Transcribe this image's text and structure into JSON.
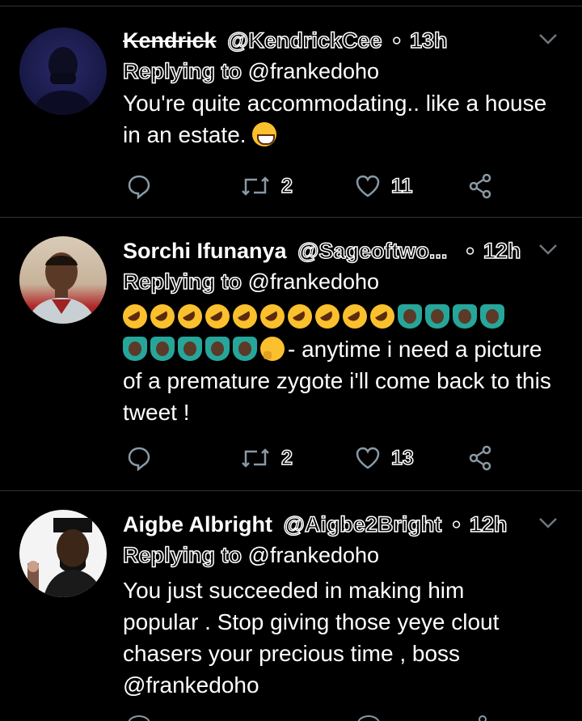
{
  "reply_prefix": "Replying",
  "reply_to_word": "to",
  "tweets": [
    {
      "name": "Kendrick",
      "handle": "@KendrickCee",
      "dot": "•",
      "time": "13h",
      "reply_target": "@frankedoho",
      "body": "You're quite accommodating.. like a house in an estate.",
      "emoji_end": "grinning-face",
      "retweets": "2",
      "likes": "11"
    },
    {
      "name": "Sorchi Ifunanya",
      "handle": "@Sageoftwo...",
      "dot": "•",
      "time": "12h",
      "reply_target": "@frankedoho",
      "body": "- anytime i need a picture of a premature zygote i'll come back to this tweet !",
      "emojis": [
        "rofl",
        "rofl",
        "rofl",
        "rofl",
        "rofl",
        "rofl",
        "rofl",
        "rofl",
        "rofl",
        "rofl",
        "facepalm",
        "facepalm",
        "facepalm",
        "facepalm",
        "facepalm",
        "facepalm",
        "facepalm",
        "facepalm",
        "facepalm",
        "thinking"
      ],
      "retweets": "2",
      "likes": "13"
    },
    {
      "name": "Aigbe Albright",
      "handle": "@Aigbe2Bright",
      "dot": "•",
      "time": "12h",
      "reply_target": "@frankedoho",
      "body": "You just succeeded in making him popular . Stop giving those yeye clout chasers your precious time , boss @frankedoho"
    }
  ],
  "colors": {
    "background": "#000000",
    "divider": "#2f3336",
    "icon_gray": "#8899a6",
    "text": "#ffffff"
  }
}
